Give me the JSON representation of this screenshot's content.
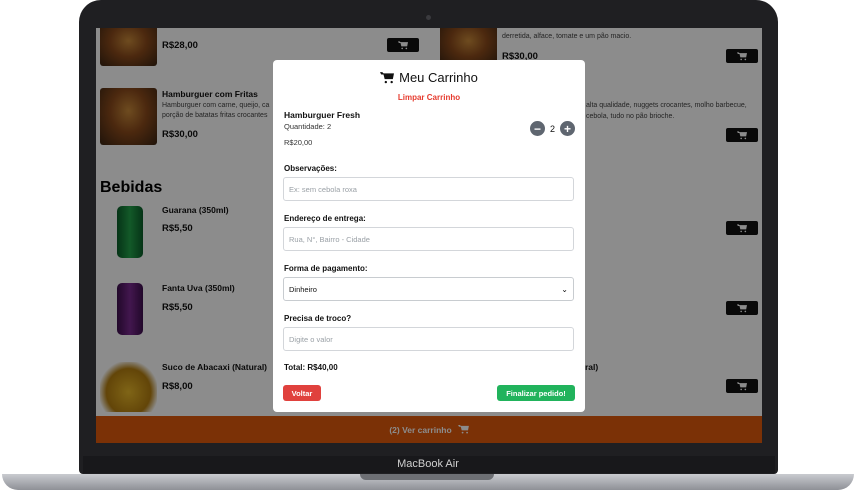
{
  "device": {
    "brand_label": "MacBook Air"
  },
  "menu": {
    "items_top": [
      {
        "price": "R$28,00"
      },
      {
        "desc": "derretida, alface, tomate e um pão macio.",
        "price": "R$30,00"
      }
    ],
    "burger_fries": {
      "name": "Hamburguer com Fritas",
      "desc": "Hamburguer com carne, queijo, ca porção de batatas fritas crocantes",
      "price": "R$30,00"
    },
    "right_mid_desc": {
      "line1": "alta qualidade, nuggets crocantes, molho barbecue,",
      "line2": "cebola, tudo no pão brioche."
    },
    "section_drinks": "Bebidas",
    "drinks": [
      {
        "name": "Guarana (350ml)",
        "price": "R$5,50"
      },
      {
        "name": "Fanta Uva (350ml)",
        "price": "R$5,50"
      },
      {
        "name": "Suco de Abacaxi (Natural)",
        "price": "R$8,00"
      }
    ],
    "right_partial": [
      "l)",
      "l)",
      "ral)"
    ],
    "cart_bar_label": "(2)  Ver carrinho"
  },
  "modal": {
    "title": "Meu Carrinho",
    "clear_label": "Limpar Carrinho",
    "item": {
      "name": "Hamburguer Fresh",
      "quantity_label": "Quantidade: 2",
      "price": "R$20,00",
      "qty": "2"
    },
    "notes": {
      "label": "Observações:",
      "placeholder": "Ex: sem cebola roxa"
    },
    "address": {
      "label": "Endereço de entrega:",
      "placeholder": "Rua, N°, Bairro - Cidade"
    },
    "payment": {
      "label": "Forma de pagamento:",
      "selected": "Dinheiro"
    },
    "change": {
      "label": "Precisa de troco?",
      "placeholder": "Digite o valor"
    },
    "total": "Total: R$40,00",
    "back_label": "Voltar",
    "finish_label": "Finalizar pedido!"
  },
  "colors": {
    "accent": "#e0590c",
    "danger": "#e0413d",
    "success": "#21b35c"
  }
}
